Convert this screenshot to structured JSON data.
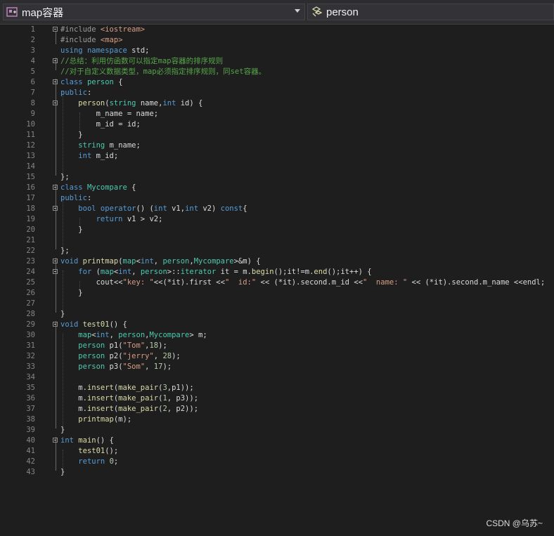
{
  "toolbar": {
    "scope_dropdown": "map容器",
    "member_dropdown": "person"
  },
  "editor": {
    "lines": [
      {
        "n": "1",
        "t": "#include <iostream>"
      },
      {
        "n": "2",
        "t": "#include <map>"
      },
      {
        "n": "3",
        "t": "using namespace std;"
      },
      {
        "n": "4",
        "t": "//总结：利用仿函数可以指定map容器的排序规则"
      },
      {
        "n": "5",
        "t": "//对于自定义数据类型，map必须指定排序规则，同set容器。"
      },
      {
        "n": "6",
        "t": "class person {"
      },
      {
        "n": "7",
        "t": "public:"
      },
      {
        "n": "8",
        "t": "    person(string name,int id) {"
      },
      {
        "n": "9",
        "t": "        m_name = name;"
      },
      {
        "n": "10",
        "t": "        m_id = id;"
      },
      {
        "n": "11",
        "t": "    }"
      },
      {
        "n": "12",
        "t": "    string m_name;"
      },
      {
        "n": "13",
        "t": "    int m_id;"
      },
      {
        "n": "14",
        "t": ""
      },
      {
        "n": "15",
        "t": "};"
      },
      {
        "n": "16",
        "t": "class Mycompare {"
      },
      {
        "n": "17",
        "t": "public:"
      },
      {
        "n": "18",
        "t": "    bool operator() (int v1,int v2) const{"
      },
      {
        "n": "19",
        "t": "        return v1 > v2;"
      },
      {
        "n": "20",
        "t": "    }"
      },
      {
        "n": "21",
        "t": ""
      },
      {
        "n": "22",
        "t": "};"
      },
      {
        "n": "23",
        "t": "void printmap(map<int, person,Mycompare>&m) {"
      },
      {
        "n": "24",
        "t": "    for (map<int, person>::iterator it = m.begin();it!=m.end();it++) {"
      },
      {
        "n": "25",
        "t": "        cout<<\"key: \"<<(*it).first <<\"  id:\" << (*it).second.m_id <<\"  name: \" << (*it).second.m_name <<endl;"
      },
      {
        "n": "26",
        "t": "    }"
      },
      {
        "n": "27",
        "t": ""
      },
      {
        "n": "28",
        "t": "}"
      },
      {
        "n": "29",
        "t": "void test01() {"
      },
      {
        "n": "30",
        "t": "    map<int, person,Mycompare> m;"
      },
      {
        "n": "31",
        "t": "    person p1(\"Tom\",18);"
      },
      {
        "n": "32",
        "t": "    person p2(\"jerry\", 28);"
      },
      {
        "n": "33",
        "t": "    person p3(\"Som\", 17);"
      },
      {
        "n": "34",
        "t": ""
      },
      {
        "n": "35",
        "t": "    m.insert(make_pair(3,p1));"
      },
      {
        "n": "36",
        "t": "    m.insert(make_pair(1, p3));"
      },
      {
        "n": "37",
        "t": "    m.insert(make_pair(2, p2));"
      },
      {
        "n": "38",
        "t": "    printmap(m);"
      },
      {
        "n": "39",
        "t": "}"
      },
      {
        "n": "40",
        "t": "int main() {"
      },
      {
        "n": "41",
        "t": "    test01();"
      },
      {
        "n": "42",
        "t": "    return 0;"
      },
      {
        "n": "43",
        "t": "}"
      }
    ]
  },
  "watermark": "CSDN @乌苏~"
}
